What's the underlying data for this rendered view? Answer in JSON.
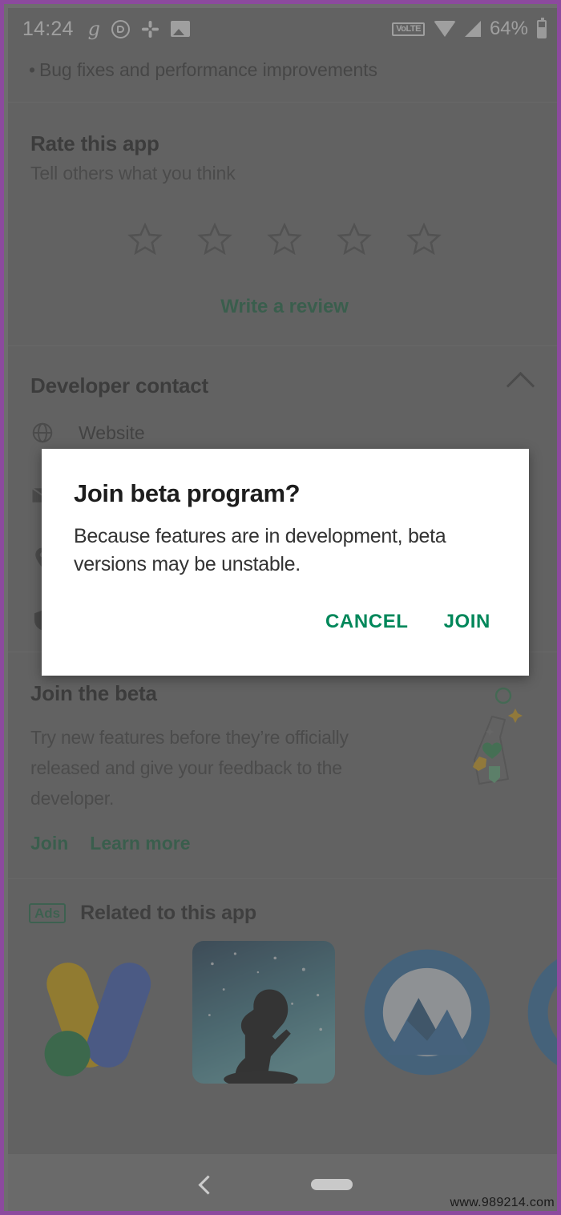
{
  "status_bar": {
    "time": "14:24",
    "battery_percent": "64%",
    "network_badge": "VoLTE",
    "left_icons": [
      "g-app-icon",
      "whatsapp-icon",
      "slack-icon",
      "photo-icon"
    ],
    "right_icons": [
      "volte-icon",
      "wifi-icon",
      "signal-icon",
      "battery-icon"
    ]
  },
  "changelog": {
    "bullet": "•",
    "text": "Bug fixes and performance improvements"
  },
  "rate_section": {
    "title": "Rate this app",
    "subtitle": "Tell others what you think",
    "stars": 5,
    "stars_filled": 0,
    "write_review": "Write a review"
  },
  "developer_contact": {
    "title": "Developer contact",
    "collapse_icon": "chevron-up-icon",
    "rows": [
      {
        "label": "Website",
        "icon": "globe-icon"
      },
      {
        "label": "",
        "icon": "email-icon"
      },
      {
        "label": "",
        "icon": "location-pin-icon"
      },
      {
        "label": "",
        "icon": "shield-icon"
      }
    ]
  },
  "beta_section": {
    "title": "Join the beta",
    "body": "Try new features before they’re officially released and give your feedback to the developer.",
    "join_label": "Join",
    "learn_more_label": "Learn more",
    "illustration": "beaker-icon"
  },
  "ads_section": {
    "badge": "Ads",
    "title": "Related to this app",
    "apps": [
      "google-ads-app-icon",
      "reading-app-icon",
      "vpn-app-icon",
      "partial-app-icon"
    ]
  },
  "dialog": {
    "title": "Join beta program?",
    "body": "Because features are in development, beta versions may be unstable.",
    "cancel_label": "CANCEL",
    "join_label": "JOIN"
  },
  "nav_bar": {
    "back_icon": "back-chevron-icon",
    "home_icon": "home-pill-icon"
  },
  "watermark": "www.989214.com",
  "colors": {
    "accent_green": "#00875A",
    "link_green": "#14653f",
    "scrim": "rgba(90,90,90,0.55)",
    "frame_purple": "#8c4a9e",
    "page_bg": "#6e6e6e"
  }
}
